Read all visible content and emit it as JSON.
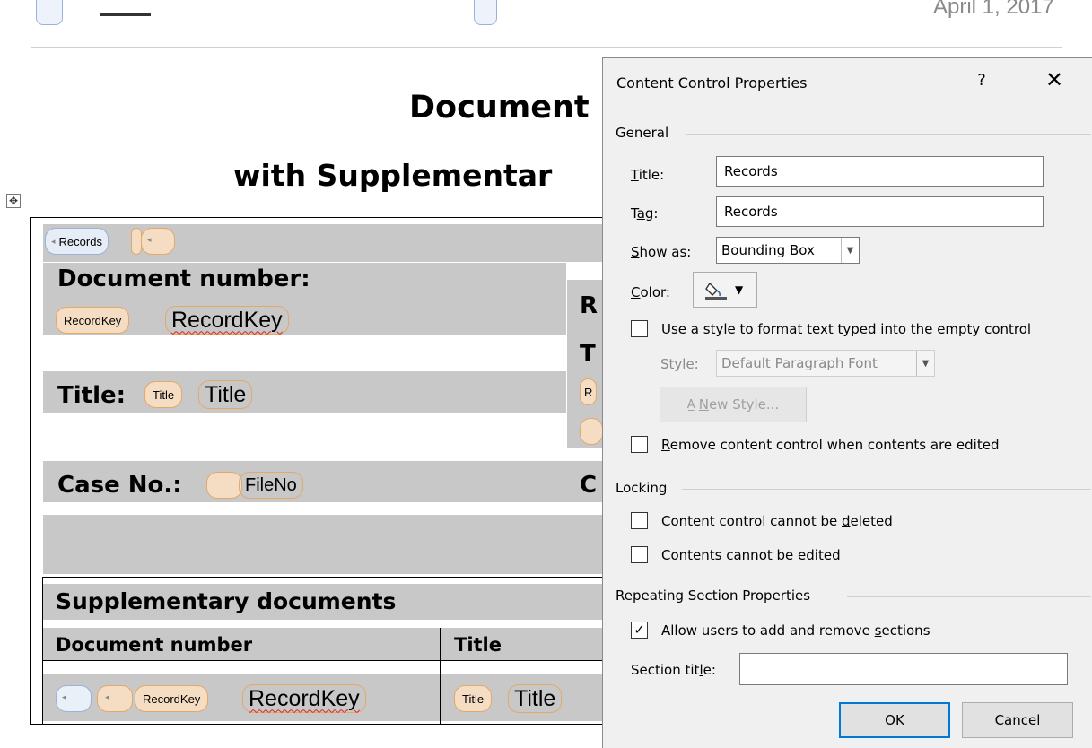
{
  "document": {
    "date": "April 1, 2017",
    "heading_line1": "Document",
    "heading_line2": "with Supplementar",
    "records_tag": "Records",
    "doc_number_label": "Document number:",
    "recordkey_tag": "RecordKey",
    "recordkey_value": "RecordKey",
    "title_label": "Title:",
    "title_tag": "Title",
    "title_value": "Title",
    "case_label": "Case No.:",
    "fileno_value": "FileNo",
    "right_col_r": "R",
    "right_col_t": "T",
    "right_col_r2": "R",
    "right_col_c": "C",
    "supp_heading": "Supplementary documents",
    "col_document_number": "Document number",
    "col_title": "Title",
    "row_recordkey_tag": "RecordKey",
    "row_recordkey_value": "RecordKey",
    "row_title_tag": "Title",
    "row_title_value": "Title"
  },
  "dialog": {
    "title": "Content Control Properties",
    "help": "?",
    "close": "✕",
    "general": {
      "group_label": "General",
      "title_label": "Title:",
      "title_value": "Records",
      "tag_label": "Tag:",
      "tag_value": "Records",
      "show_as_label": "Show as:",
      "show_as_value": "Bounding Box",
      "color_label": "Color:",
      "use_style_label": "Use a style to format text typed into the empty control",
      "use_style_checked": false,
      "style_label": "Style:",
      "style_value": "Default Paragraph Font",
      "new_style_label": "New Style...",
      "remove_label": "Remove content control when contents are edited",
      "remove_checked": false
    },
    "locking": {
      "group_label": "Locking",
      "cannot_delete_label": "Content control cannot be deleted",
      "cannot_delete_checked": false,
      "cannot_edit_label": "Contents cannot be edited",
      "cannot_edit_checked": false
    },
    "repeating": {
      "group_label": "Repeating Section Properties",
      "allow_label": "Allow users to add and remove sections",
      "allow_checked": true,
      "section_title_label": "Section title:",
      "section_title_value": ""
    },
    "buttons": {
      "ok": "OK",
      "cancel": "Cancel"
    }
  }
}
